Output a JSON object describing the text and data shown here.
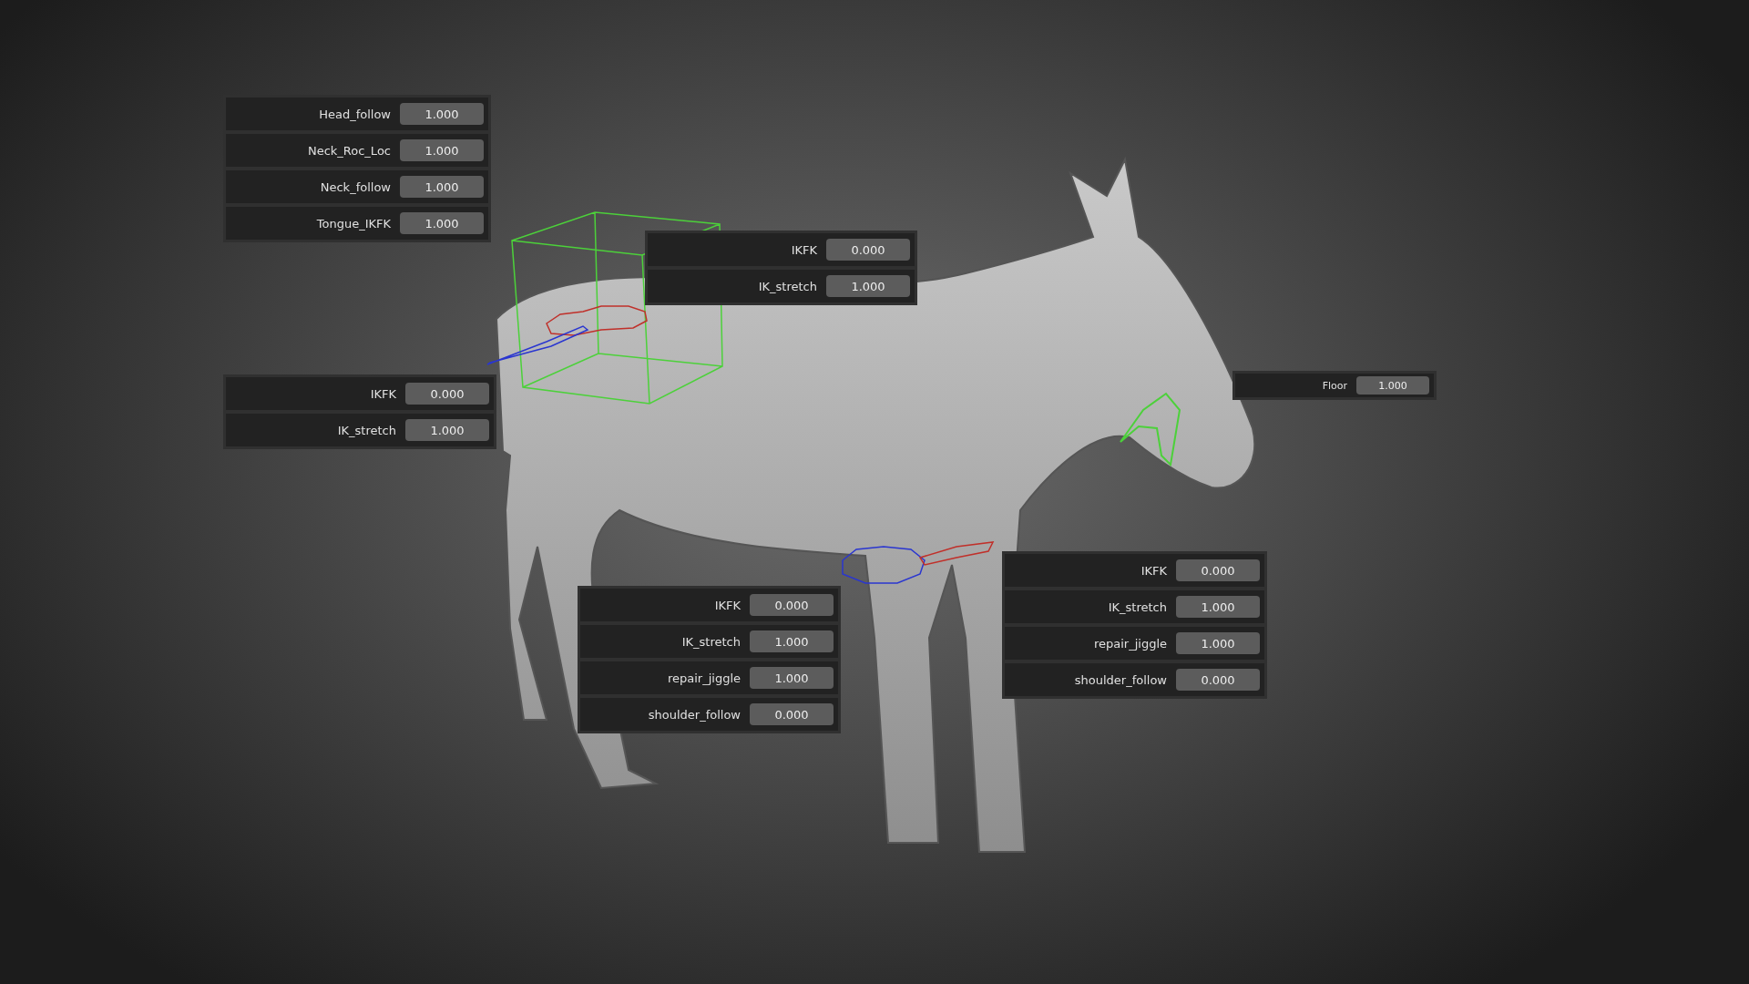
{
  "panels": [
    {
      "kind": "standard",
      "rows": [
        {
          "label": "Head_follow",
          "value": "1.000"
        },
        {
          "label": "Neck_Roc_Loc",
          "value": "1.000"
        },
        {
          "label": "Neck_follow",
          "value": "1.000"
        },
        {
          "label": "Tongue_IKFK",
          "value": "1.000"
        }
      ]
    },
    {
      "kind": "standard",
      "rows": [
        {
          "label": "IKFK",
          "value": "0.000"
        },
        {
          "label": "IK_stretch",
          "value": "1.000"
        }
      ]
    },
    {
      "kind": "standard",
      "rows": [
        {
          "label": "IKFK",
          "value": "0.000"
        },
        {
          "label": "IK_stretch",
          "value": "1.000"
        }
      ]
    },
    {
      "kind": "compact",
      "rows": [
        {
          "label": "Floor",
          "value": "1.000"
        }
      ]
    },
    {
      "kind": "standard",
      "rows": [
        {
          "label": "IKFK",
          "value": "0.000"
        },
        {
          "label": "IK_stretch",
          "value": "1.000"
        },
        {
          "label": "repair_jiggle",
          "value": "1.000"
        },
        {
          "label": "shoulder_follow",
          "value": "0.000"
        }
      ]
    },
    {
      "kind": "standard",
      "rows": [
        {
          "label": "IKFK",
          "value": "0.000"
        },
        {
          "label": "IK_stretch",
          "value": "1.000"
        },
        {
          "label": "repair_jiggle",
          "value": "1.000"
        },
        {
          "label": "shoulder_follow",
          "value": "0.000"
        }
      ]
    }
  ]
}
